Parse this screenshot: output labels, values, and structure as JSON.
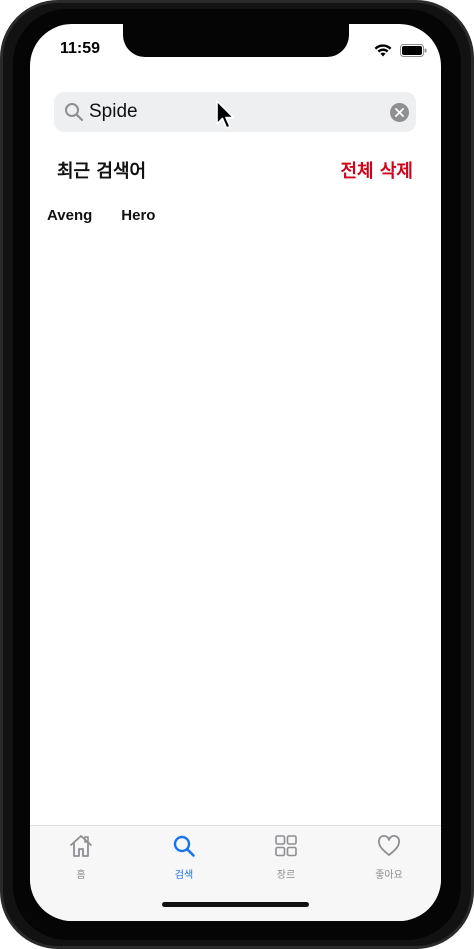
{
  "status_bar": {
    "time": "11:59"
  },
  "search": {
    "value": "Spide"
  },
  "recent": {
    "title": "최근 검색어",
    "delete_all_label": "전체 삭제",
    "items": [
      "Aveng",
      "Hero"
    ]
  },
  "tabs": [
    {
      "label": "홈",
      "icon": "home-icon",
      "active": false
    },
    {
      "label": "검색",
      "icon": "search-icon",
      "active": true
    },
    {
      "label": "장르",
      "icon": "grid-icon",
      "active": false
    },
    {
      "label": "좋아요",
      "icon": "heart-icon",
      "active": false
    }
  ],
  "colors": {
    "accent": "#1a73e8",
    "destructive": "#d0021b",
    "inactive_tab": "#8e8e93"
  }
}
